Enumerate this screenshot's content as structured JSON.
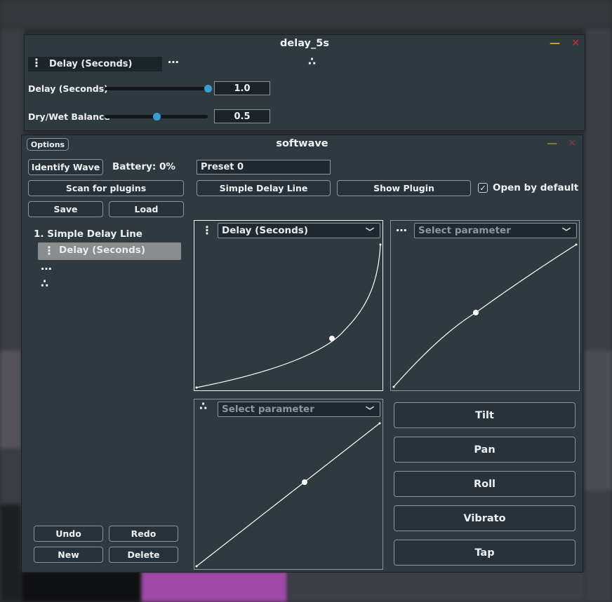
{
  "delay_window": {
    "title": "delay_5s",
    "tab_label": "Delay (Seconds)",
    "params": [
      {
        "label": "Delay (Seconds)",
        "value": "1.0",
        "fraction": 1.0
      },
      {
        "label": "Dry/Wet Balance",
        "value": "0.5",
        "fraction": 0.5
      }
    ]
  },
  "main_window": {
    "title": "softwave",
    "options_label": "Options",
    "identify_label": "Identify Wave",
    "battery_text": "Battery: 0%",
    "scan_label": "Scan for plugins",
    "save_label": "Save",
    "load_label": "Load",
    "preset_value": "Preset 0",
    "plugin_button_label": "Simple Delay Line",
    "show_plugin_label": "Show Plugin",
    "open_default_label": "Open by default",
    "open_default_checked": true,
    "tree": {
      "plugin": "1. Simple Delay Line",
      "selected_param": "Delay (Seconds)"
    },
    "undo_label": "Undo",
    "redo_label": "Redo",
    "new_label": "New",
    "delete_label": "Delete",
    "curves": [
      {
        "param": "Delay (Seconds)",
        "placeholder": false,
        "shape": "exponential"
      },
      {
        "param": "Select parameter",
        "placeholder": true,
        "shape": "concave"
      },
      {
        "param": "Select parameter",
        "placeholder": true,
        "shape": "linear"
      }
    ],
    "actions": [
      "Tilt",
      "Pan",
      "Roll",
      "Vibrato",
      "Tap"
    ]
  },
  "colors": {
    "accent": "#3a9fd0",
    "minimize": "#d4a21e",
    "close": "#c42b2b",
    "panel_bg": "#2f3a40"
  },
  "icons": {
    "vertical_dots": "⋮",
    "horizontal_dots": "⋯",
    "triangle_dots": "∴",
    "chevron": "﹀",
    "check": "✓",
    "minimize": "—",
    "close": "✕"
  }
}
